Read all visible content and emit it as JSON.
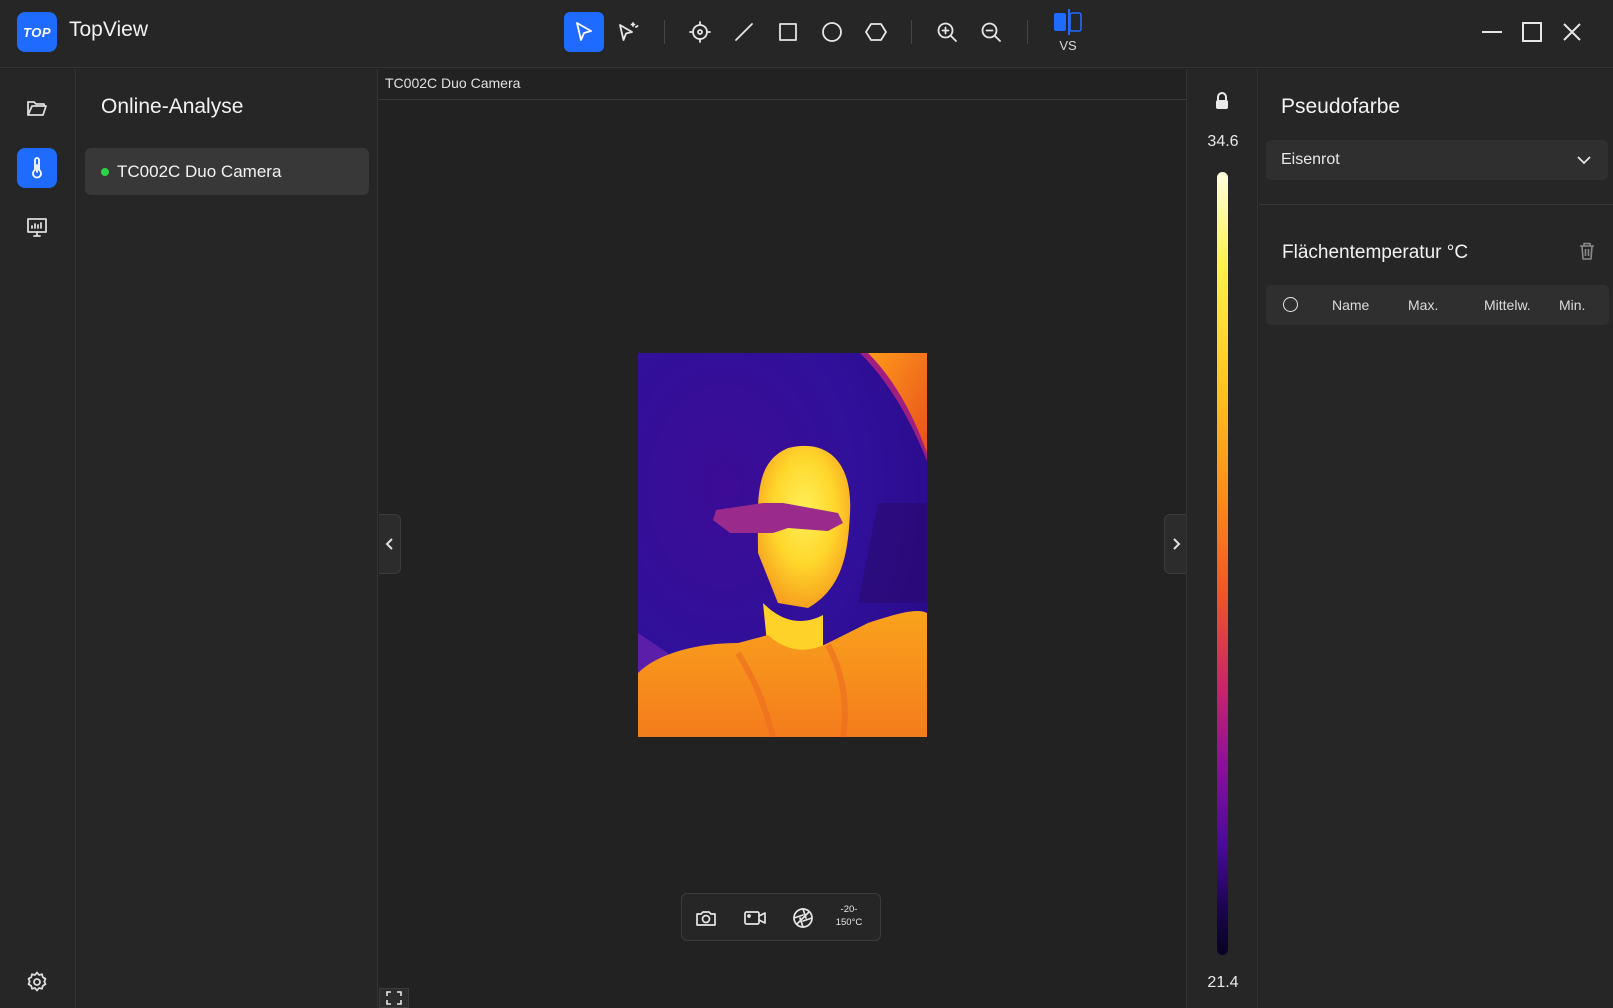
{
  "app": {
    "logo_text": "TOP",
    "title": "TopView"
  },
  "toolbar": {
    "tools": [
      "select-tool",
      "multi-select-tool",
      "point-tool",
      "line-tool",
      "rectangle-tool",
      "circle-tool",
      "polygon-tool",
      "zoom-in",
      "zoom-out"
    ],
    "active_tool": "select-tool",
    "vs_label": "VS"
  },
  "sidebar": {
    "items": [
      "folder",
      "thermometer",
      "monitor",
      "settings"
    ],
    "active_item": "thermometer"
  },
  "device_panel": {
    "title": "Online-Analyse",
    "devices": [
      {
        "name": "TC002C Duo Camera",
        "status": "online",
        "status_color": "#2bd34a"
      }
    ]
  },
  "viewer": {
    "header": "TC002C Duo Camera",
    "capture": {
      "range_line1": "-20-",
      "range_line2": "150°C"
    }
  },
  "scale": {
    "max": "34.6",
    "min": "21.4",
    "locked": true
  },
  "pseudocolor": {
    "title": "Pseudofarbe",
    "selected": "Eisenrot"
  },
  "area_temperature": {
    "title": "Flächentemperatur °C",
    "columns": [
      "Name",
      "Max.",
      "Mittelw.",
      "Min."
    ],
    "rows": []
  },
  "colors": {
    "accent": "#1f6bff",
    "background": "#232323"
  }
}
